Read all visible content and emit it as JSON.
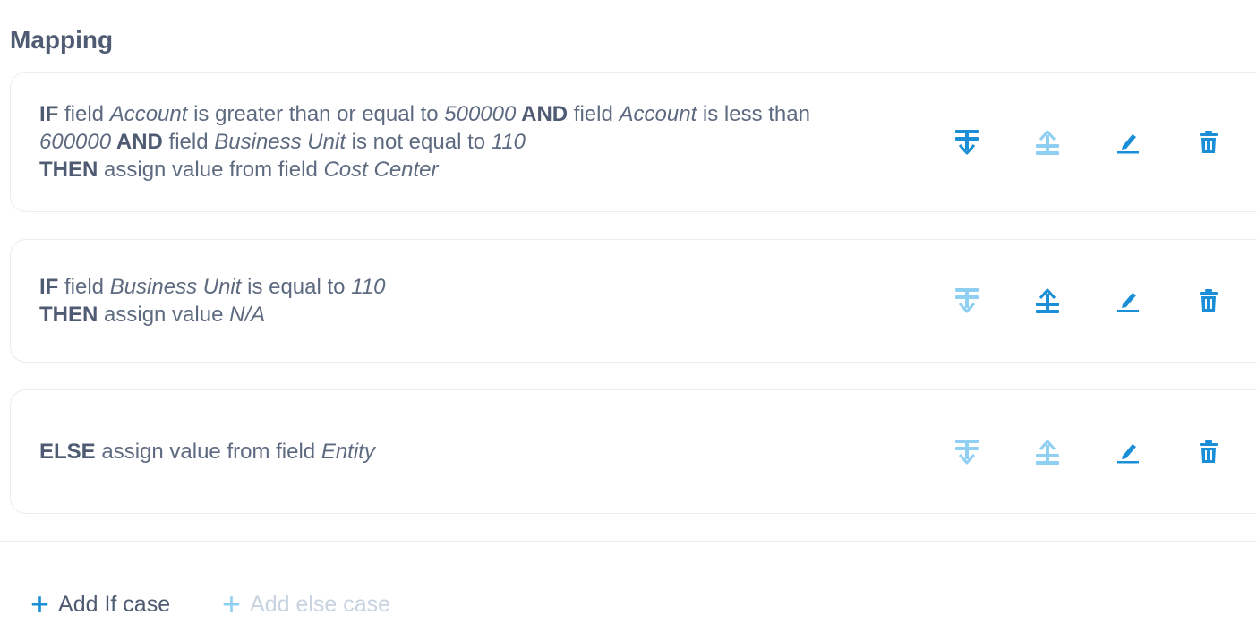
{
  "title": "Mapping",
  "rules": [
    {
      "line1": {
        "kw_if": "IF",
        "t1": " field ",
        "field1": "Account",
        "t2": " is greater than or equal to ",
        "val1": "500000",
        "kw_and1": " AND",
        "t3": " field ",
        "field2": "Account",
        "t4": " is less than"
      },
      "line2": {
        "val2": "600000",
        "kw_and2": " AND",
        "t5": " field ",
        "field3": "Business Unit",
        "t6": " is not equal to ",
        "val3": "110"
      },
      "line3": {
        "kw_then": "THEN",
        "t7": " assign value from field ",
        "field4": "Cost Center"
      },
      "actions": {
        "move_down": "move-down",
        "move_up": "move-up",
        "edit": "edit",
        "delete": "delete",
        "move_down_enabled": true,
        "move_up_enabled": false
      }
    },
    {
      "line1": {
        "kw_if": "IF",
        "t1": " field ",
        "field1": "Business Unit",
        "t2": " is equal to ",
        "val1": "110"
      },
      "line2": {
        "kw_then": "THEN",
        "t3": " assign value ",
        "val2": "N/A"
      },
      "actions": {
        "move_down_enabled": false,
        "move_up_enabled": true
      }
    },
    {
      "line1": {
        "kw_else": "ELSE",
        "t1": " assign value from field ",
        "field1": "Entity"
      },
      "actions": {
        "move_down_enabled": false,
        "move_up_enabled": false
      }
    }
  ],
  "footer": {
    "add_if_icon": "+",
    "add_if_label": "Add If case",
    "add_else_icon": "+",
    "add_else_label": "Add else case"
  },
  "colors": {
    "accent": "#1a8ed6",
    "accent_disabled": "#8fd0f2",
    "text": "#5d6a80",
    "heading": "#4f5b72",
    "disabled_text": "#c8d3e0",
    "border": "#e9ecf1"
  },
  "icons": [
    "move-down-icon",
    "move-up-icon",
    "pencil-icon",
    "trash-icon",
    "plus-icon"
  ]
}
